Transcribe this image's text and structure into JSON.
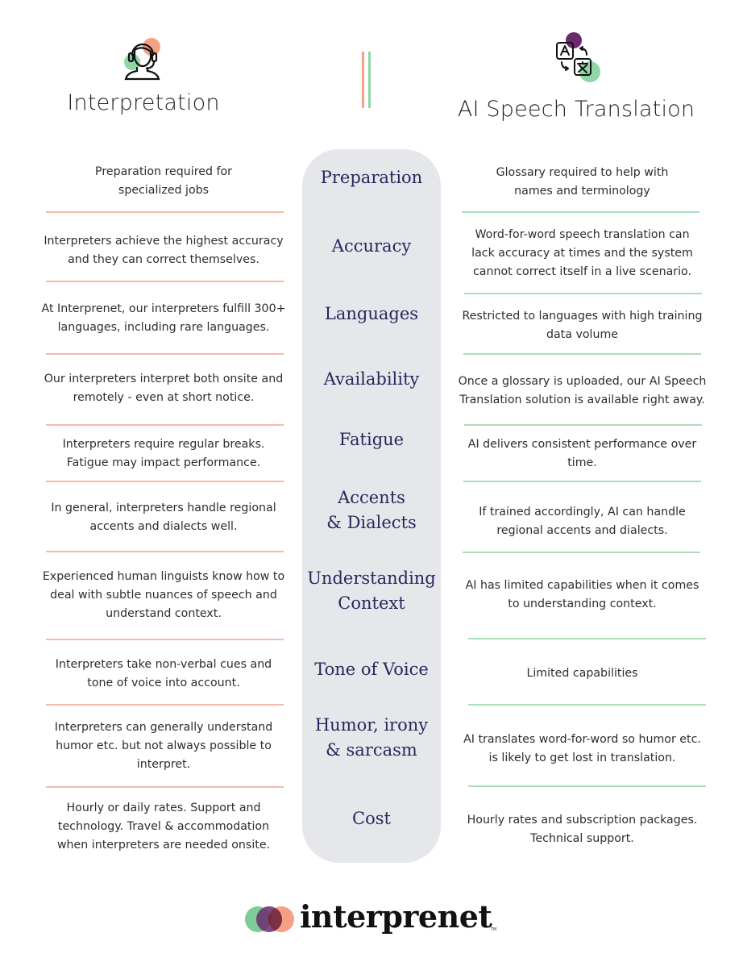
{
  "header": {
    "left_title": "Interpretation",
    "right_title": "AI Speech Translation",
    "left_icon": "interpreter-headset-icon",
    "right_icon": "translate-icon"
  },
  "colors": {
    "orange": "#f4a285",
    "green": "#8fd6a5",
    "purple": "#6b2a6e",
    "navy": "#27285e",
    "pill_bg": "#e6e7ea"
  },
  "rows": [
    {
      "category": "Preparation",
      "interpretation": "Preparation required for\nspecialized jobs",
      "ai": "Glossary required to help with\nnames and terminology"
    },
    {
      "category": "Accuracy",
      "interpretation": "Interpreters achieve the highest accuracy\nand they can correct themselves.",
      "ai": "Word-for-word speech translation can\nlack accuracy at times and the system\ncannot correct itself in a live scenario."
    },
    {
      "category": "Languages",
      "interpretation": "At Interprenet, our interpreters fulfill 300+\nlanguages, including rare languages.",
      "ai": "Restricted to languages with high training\ndata volume"
    },
    {
      "category": "Availability",
      "interpretation": "Our interpreters interpret both onsite and\nremotely - even at short notice.",
      "ai": "Once a glossary is uploaded, our AI Speech\nTranslation solution is available right away."
    },
    {
      "category": "Fatigue",
      "interpretation": "Interpreters require regular breaks.\nFatigue may impact performance.",
      "ai": "AI delivers consistent performance over\ntime."
    },
    {
      "category": "Accents\n& Dialects",
      "interpretation": "In general, interpreters handle regional\naccents and dialects well.",
      "ai": "If trained accordingly, AI can handle\nregional accents and dialects."
    },
    {
      "category": "Understanding\nContext",
      "interpretation": "Experienced human linguists know how to\ndeal with subtle nuances of speech and\nunderstand context.",
      "ai": "AI has limited capabilities when it comes\nto understanding context."
    },
    {
      "category": "Tone of Voice",
      "interpretation": "Interpreters take non-verbal cues and\ntone of voice into account.",
      "ai": "Limited capabilities"
    },
    {
      "category": "Humor, irony\n& sarcasm",
      "interpretation": "Interpreters can generally understand\nhumor etc. but not always possible to\ninterpret.",
      "ai": "AI translates word-for-word so humor etc.\nis likely to get lost in translation."
    },
    {
      "category": "Cost",
      "interpretation": "Hourly or daily rates. Support and\ntechnology. Travel & accommodation\nwhen interpreters are needed onsite.",
      "ai": "Hourly rates and subscription packages.\nTechnical support."
    }
  ],
  "footer": {
    "brand": "interprenet",
    "trademark": "TM"
  }
}
